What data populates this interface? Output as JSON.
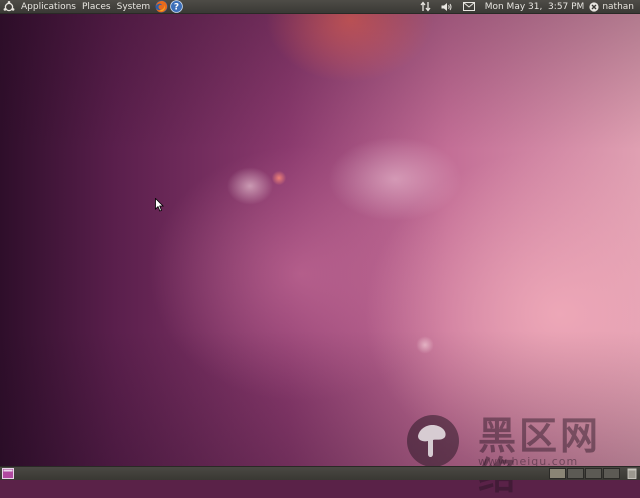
{
  "top_panel": {
    "menus": [
      "Applications",
      "Places",
      "System"
    ],
    "launchers": [
      {
        "icon": "firefox-icon",
        "label": "Firefox"
      },
      {
        "icon": "help-icon",
        "label": "Help"
      }
    ],
    "tray": {
      "network_icon": "network-updown-icon",
      "volume_icon": "volume-icon",
      "mail_icon": "mail-icon",
      "clock": "Mon May 31,  3:57 PM",
      "user": "nathan",
      "user_icon": "session-x-icon"
    }
  },
  "desktop": {
    "wallpaper": "ubuntu-purple-bokeh",
    "colors": {
      "primary": "#8b3a6e",
      "panel": "#3f3e3a"
    }
  },
  "bottom_panel": {
    "show_desktop_icon": "show-desktop-icon",
    "workspace_count": 4,
    "active_workspace": 1,
    "trash_icon": "trash-icon"
  },
  "watermark": {
    "title": "黑区网络",
    "url": "www.heiqu.com"
  }
}
